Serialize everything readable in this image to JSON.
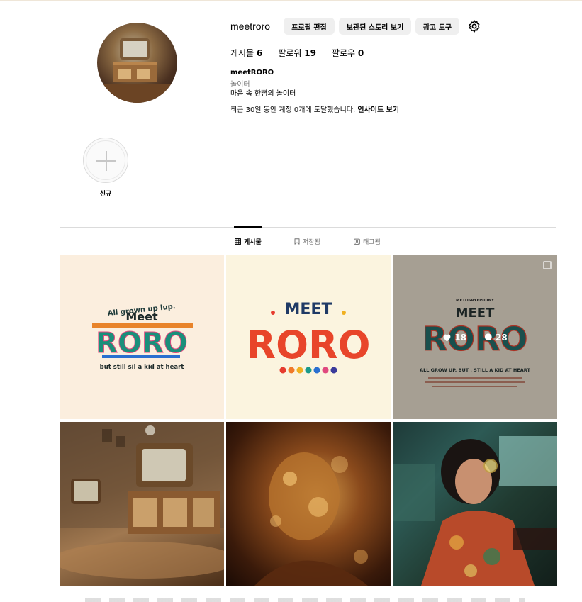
{
  "profile": {
    "username": "meetroro",
    "edit_label": "프로필 편집",
    "archive_label": "보관된 스토리 보기",
    "ads_label": "광고 도구",
    "stats": {
      "posts_label": "게시물",
      "posts_count": "6",
      "followers_label": "팔로워",
      "followers_count": "19",
      "following_label": "팔로우",
      "following_count": "0"
    },
    "display_name": "meetRORO",
    "category": "놀이터",
    "bio": "마음 속 한뼘의 놀이터",
    "reach_text": "최근 30일 동안 계정 0개에 도달했습니다.",
    "insights_link": "인사이트 보기"
  },
  "highlights": [
    {
      "label": "신규",
      "icon": "plus-icon"
    }
  ],
  "tabs": [
    {
      "label": "게시물",
      "icon": "grid-icon",
      "active": true
    },
    {
      "label": "저장됨",
      "icon": "bookmark-icon",
      "active": false
    },
    {
      "label": "태그됨",
      "icon": "tag-icon",
      "active": false
    }
  ],
  "posts": [
    {
      "kind": "logo",
      "top_text": "All grown up lup.",
      "meet": "Meet",
      "roro": "RORO",
      "bottom_text": "but still sil a kid at heart"
    },
    {
      "kind": "logo",
      "meet": "MEET",
      "roro": "RORO"
    },
    {
      "kind": "logo",
      "top_text": "METOSRYFISIIINY",
      "meet": "MEET",
      "roro": "RORO",
      "bottom_text": "ALL GROW UP, BUT . STILL A KID AT HEART",
      "hover": {
        "likes": "18",
        "comments": "28"
      }
    },
    {
      "kind": "photo",
      "subject": "retro-tv-room"
    },
    {
      "kind": "photo",
      "subject": "portrait-in-dappled-light"
    },
    {
      "kind": "photo",
      "subject": "woman-with-sunglasses-on-train"
    }
  ],
  "colors": {
    "button_bg": "#efefef",
    "secondary_text": "#737373",
    "divider": "#dbdbdb"
  }
}
